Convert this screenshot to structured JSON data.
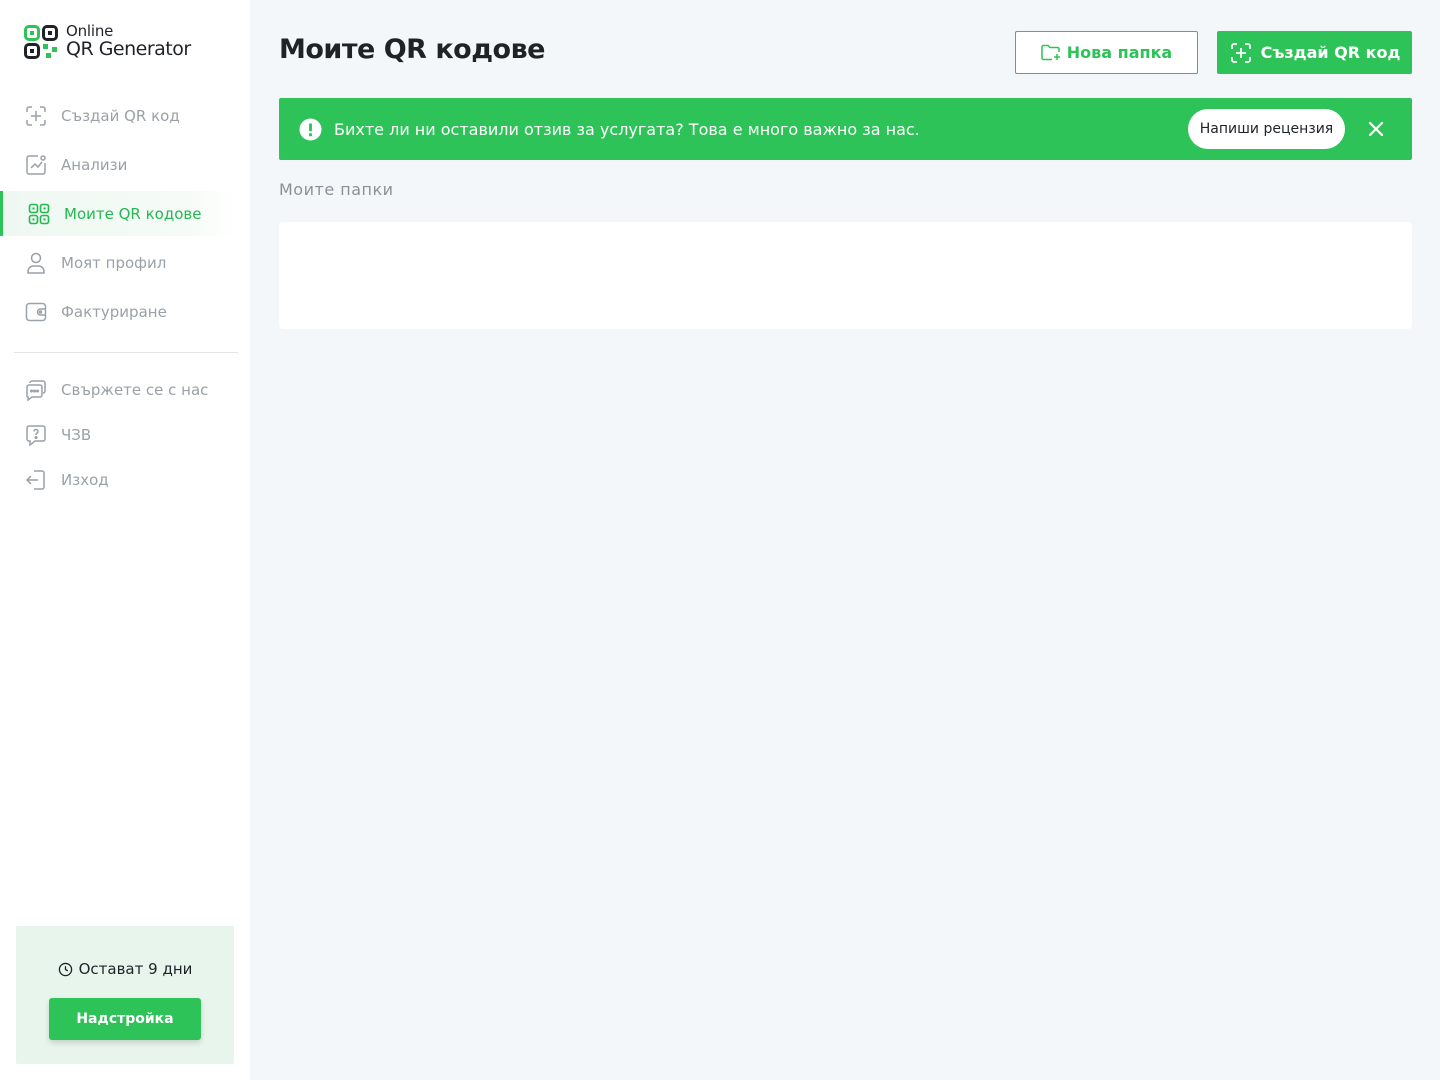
{
  "brand": {
    "line1": "Online",
    "line2": "QR Generator"
  },
  "colors": {
    "accent": "#2dc358",
    "sidebar_bg": "#ffffff",
    "page_bg": "#f3f7fa",
    "muted": "#9aa1a8"
  },
  "sidebar": {
    "items": [
      {
        "label": "Създай QR код",
        "icon": "plus-square-icon",
        "active": false
      },
      {
        "label": "Анализи",
        "icon": "chart-line-icon",
        "active": false
      },
      {
        "label": "Моите QR кодове",
        "icon": "qr-code-icon",
        "active": true
      },
      {
        "label": "Моят профил",
        "icon": "user-icon",
        "active": false
      },
      {
        "label": "Фактуриране",
        "icon": "wallet-icon",
        "active": false
      }
    ],
    "secondary": [
      {
        "label": "Свържете се с нас",
        "icon": "chat-icon"
      },
      {
        "label": "ЧЗВ",
        "icon": "question-icon"
      },
      {
        "label": "Изход",
        "icon": "logout-icon"
      }
    ],
    "trial": {
      "text": "Остават 9 дни",
      "button": "Надстройка"
    }
  },
  "header": {
    "title": "Моите QR кодове",
    "new_folder_label": "Нова папка",
    "create_label": "Създай QR код"
  },
  "banner": {
    "text": "Бихте ли ни оставили отзив за услугата? Това е много важно за нас.",
    "button": "Напиши рецензия"
  },
  "folders": {
    "label": "Моите папки"
  }
}
